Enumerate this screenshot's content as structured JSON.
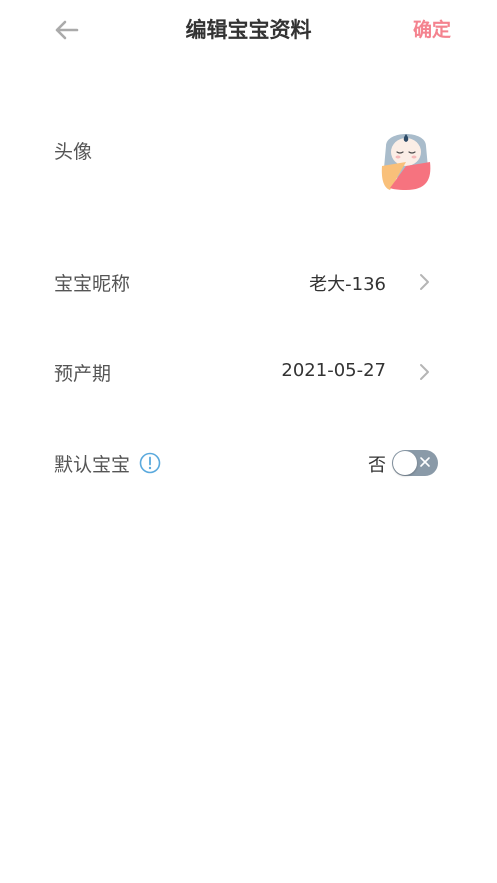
{
  "header": {
    "back_icon": "arrow-left-icon",
    "title": "编辑宝宝资料",
    "confirm_label": "确定"
  },
  "colors": {
    "accent": "#f4838f",
    "toggle_off": "#8a9aa8",
    "info_icon": "#5aa9dd"
  },
  "avatar_row": {
    "label": "头像",
    "avatar_icon": "baby-swaddle-icon"
  },
  "nickname_row": {
    "label": "宝宝昵称",
    "value": "老大-136"
  },
  "due_date_row": {
    "label": "预产期",
    "value": "2021-05-27"
  },
  "default_row": {
    "label": "默认宝宝",
    "info_icon": "info-circle-icon",
    "toggle_text": "否",
    "toggle_on": false
  }
}
